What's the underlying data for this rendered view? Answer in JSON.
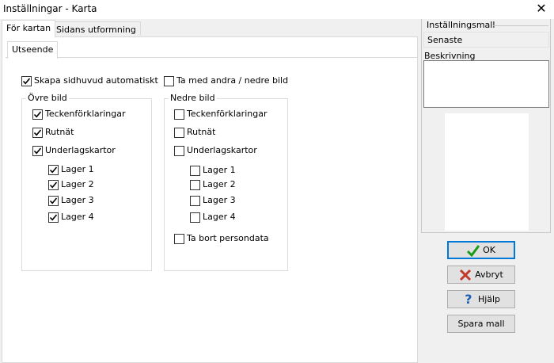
{
  "window": {
    "title": "Inställningar - Karta"
  },
  "tabs": [
    {
      "label": "För kartan",
      "active": true
    },
    {
      "label": "Sidans utformning",
      "active": false
    }
  ],
  "subtab": {
    "label": "Utseende"
  },
  "options": {
    "auto_header": {
      "label": "Skapa sidhuvud automatiskt",
      "checked": true
    },
    "include_other": {
      "label": "Ta med andra / nedre bild",
      "checked": false
    }
  },
  "upper": {
    "title": "Övre bild",
    "items": [
      {
        "label": "Teckenförklaringar",
        "checked": true
      },
      {
        "label": "Rutnät",
        "checked": true
      },
      {
        "label": "Underlagskartor",
        "checked": true
      }
    ],
    "layers": [
      {
        "label": "Lager 1",
        "checked": true
      },
      {
        "label": "Lager 2",
        "checked": true
      },
      {
        "label": "Lager 3",
        "checked": true
      },
      {
        "label": "Lager 4",
        "checked": true
      }
    ]
  },
  "lower": {
    "title": "Nedre bild",
    "items": [
      {
        "label": "Teckenförklaringar",
        "checked": false
      },
      {
        "label": "Rutnät",
        "checked": false
      },
      {
        "label": "Underlagskartor",
        "checked": false
      }
    ],
    "layers": [
      {
        "label": "Lager 1",
        "checked": false
      },
      {
        "label": "Lager 2",
        "checked": false
      },
      {
        "label": "Lager 3",
        "checked": false
      },
      {
        "label": "Lager 4",
        "checked": false
      }
    ],
    "remove_personal": {
      "label": "Ta bort persondata",
      "checked": false
    }
  },
  "template": {
    "group_label": "Inställningsmall",
    "selected": "Senaste",
    "description_label": "Beskrivning",
    "description_value": ""
  },
  "buttons": {
    "ok": "OK",
    "cancel": "Avbryt",
    "help": "Hjälp",
    "save": "Spara mall"
  },
  "colors": {
    "check": "#000000",
    "ok_icon": "#1a9b1a",
    "cancel_icon": "#c0392b",
    "help_icon": "#1a5fb4",
    "accent": "#0078d7"
  }
}
